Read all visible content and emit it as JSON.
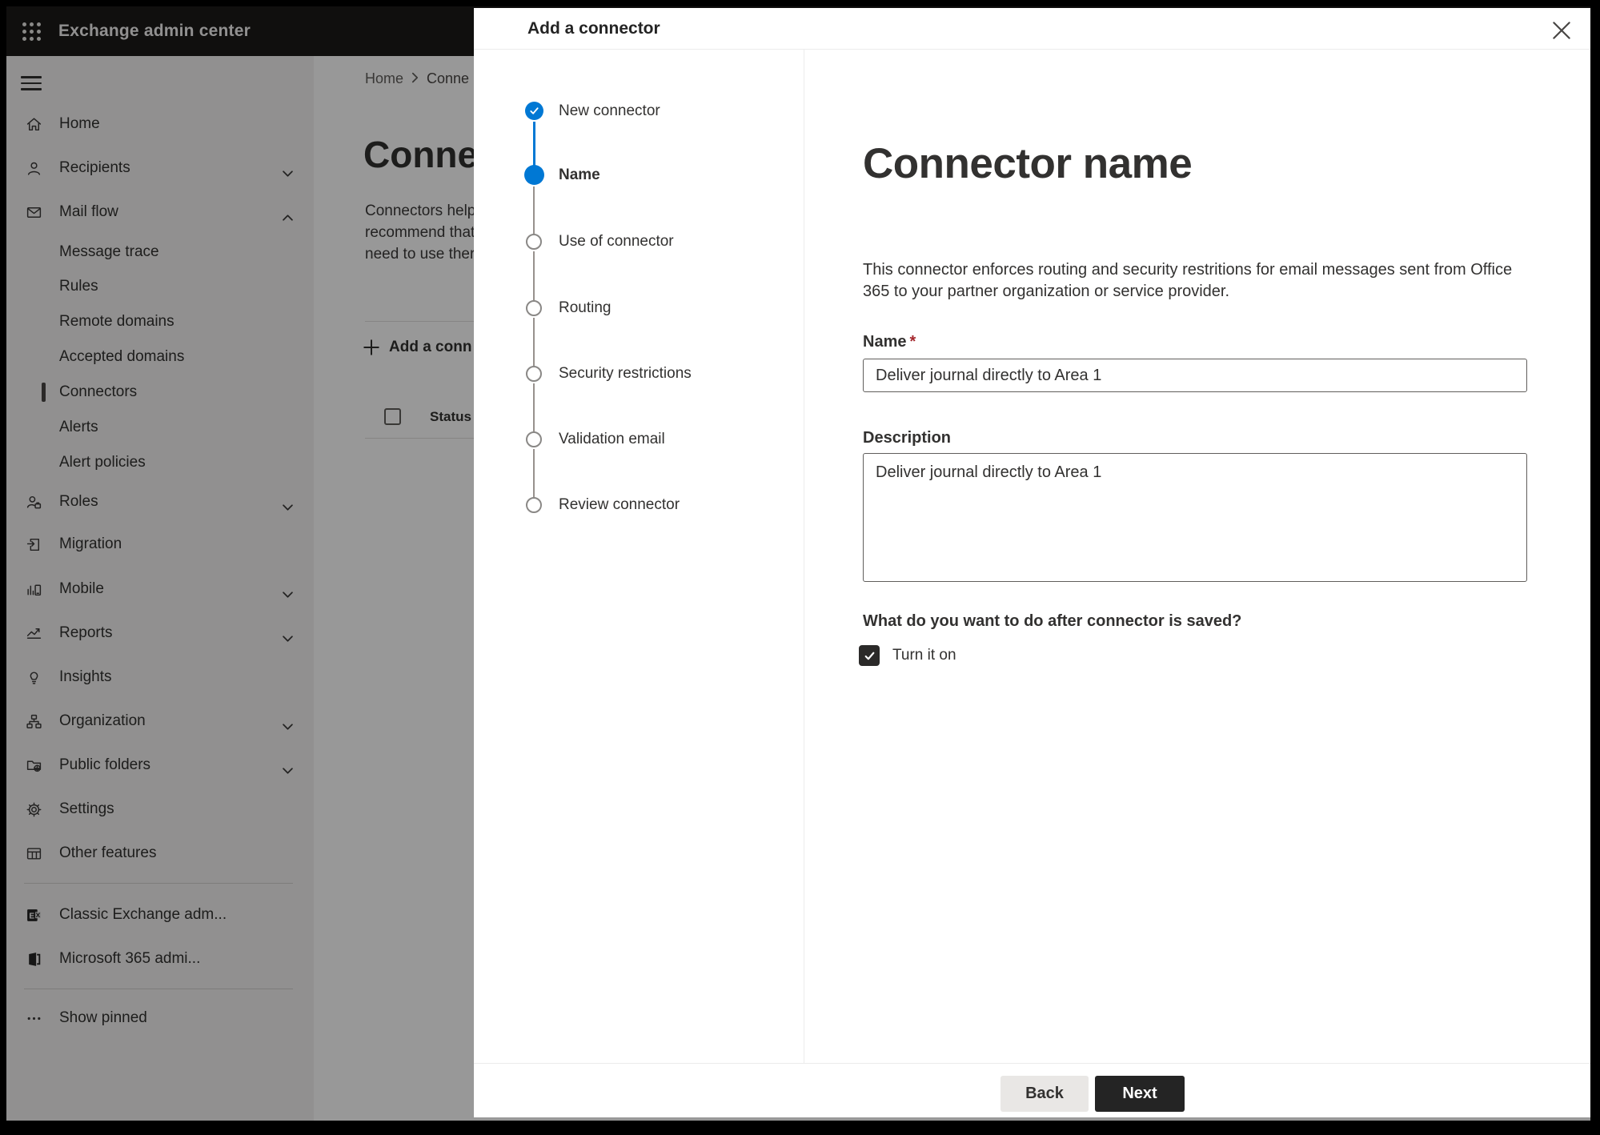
{
  "colors": {
    "accent": "#0078d4",
    "primary-button": "#242424",
    "required": "#a4262c",
    "step-future": "#8a8886",
    "ink": "#323130"
  },
  "topbar": {
    "title": "Exchange admin center"
  },
  "sidebar": {
    "items": [
      {
        "label": "Home"
      },
      {
        "label": "Recipients"
      },
      {
        "label": "Mail flow"
      },
      {
        "label": "Message trace"
      },
      {
        "label": "Rules"
      },
      {
        "label": "Remote domains"
      },
      {
        "label": "Accepted domains"
      },
      {
        "label": "Connectors"
      },
      {
        "label": "Alerts"
      },
      {
        "label": "Alert policies"
      },
      {
        "label": "Roles"
      },
      {
        "label": "Migration"
      },
      {
        "label": "Mobile"
      },
      {
        "label": "Reports"
      },
      {
        "label": "Insights"
      },
      {
        "label": "Organization"
      },
      {
        "label": "Public folders"
      },
      {
        "label": "Settings"
      },
      {
        "label": "Other features"
      },
      {
        "label": "Classic Exchange adm..."
      },
      {
        "label": "Microsoft 365 admi..."
      },
      {
        "label": "Show pinned"
      }
    ]
  },
  "page": {
    "breadcrumb": {
      "home": "Home",
      "current": "Conne"
    },
    "title": "Connect",
    "description_lines": [
      "Connectors help",
      "recommend that",
      "need to use ther"
    ],
    "add_button": "Add a conn",
    "table": {
      "status_header": "Status"
    }
  },
  "dialog": {
    "title": "Add a connector",
    "steps": [
      {
        "label": "New connector",
        "state": "complete"
      },
      {
        "label": "Name",
        "state": "current"
      },
      {
        "label": "Use of connector",
        "state": "upcoming"
      },
      {
        "label": "Routing",
        "state": "upcoming"
      },
      {
        "label": "Security restrictions",
        "state": "upcoming"
      },
      {
        "label": "Validation email",
        "state": "upcoming"
      },
      {
        "label": "Review connector",
        "state": "upcoming"
      }
    ],
    "content": {
      "heading": "Connector name",
      "description": "This connector enforces routing and security restritions for email messages sent from Office 365 to your partner organization or service provider.",
      "name_label": "Name",
      "required_mark": "*",
      "name_value": "Deliver journal directly to Area 1",
      "description_label": "Description",
      "description_value": "Deliver journal directly to Area 1",
      "question": "What do you want to do after connector is saved?",
      "checkbox_label": "Turn it on",
      "checkbox_checked": true
    },
    "footer": {
      "back": "Back",
      "next": "Next"
    }
  }
}
